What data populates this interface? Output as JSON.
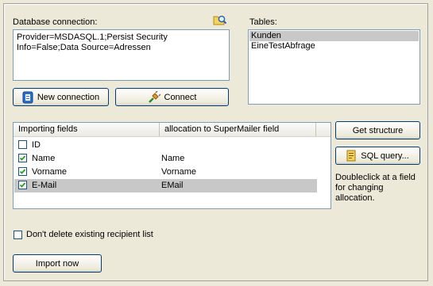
{
  "connection": {
    "label": "Database connection:",
    "value": "Provider=MSDASQL.1;Persist Security Info=False;Data Source=Adressen",
    "browse_icon": "search-folder-icon"
  },
  "tables": {
    "label": "Tables:",
    "items": [
      "Kunden",
      "EineTestAbfrage"
    ],
    "selected_index": 0
  },
  "buttons": {
    "new_connection": "New connection",
    "new_connection_icon": "database-icon",
    "connect": "Connect",
    "connect_icon": "plug-icon",
    "get_structure": "Get structure",
    "sql_query": "SQL query...",
    "sql_query_icon": "query-icon",
    "import_now": "Import now"
  },
  "fields": {
    "columns": [
      "Importing fields",
      "allocation to SuperMailer field"
    ],
    "rows": [
      {
        "field": "ID",
        "allocation": "",
        "checked": false
      },
      {
        "field": "Name",
        "allocation": "Name",
        "checked": true
      },
      {
        "field": "Vorname",
        "allocation": "Vorname",
        "checked": true
      },
      {
        "field": "E-Mail",
        "allocation": "EMail",
        "checked": true
      }
    ],
    "selected_index": 3
  },
  "hint": {
    "line1": "Doubleclick at a field",
    "line2": "for changing",
    "line3": "allocation."
  },
  "options": {
    "dont_delete_label": "Don't delete existing recipient list",
    "dont_delete_checked": false
  },
  "colors": {
    "selection": "#c8c8c8",
    "check": "#21a121",
    "window_bg": "#ece9d8"
  }
}
